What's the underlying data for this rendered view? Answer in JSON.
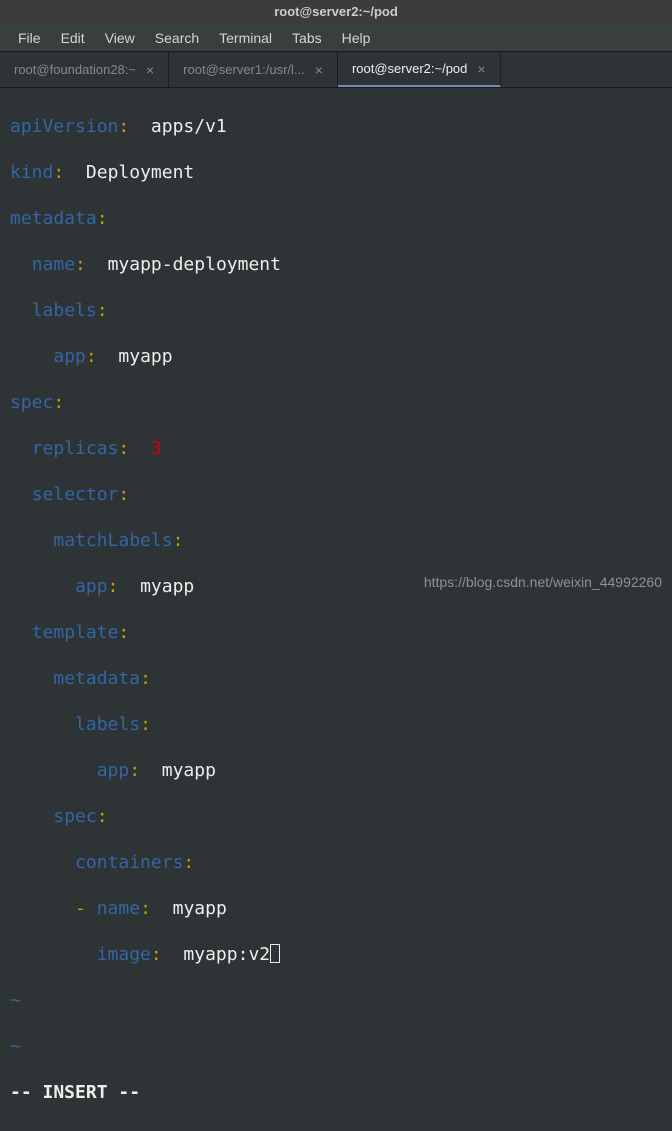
{
  "titlebar": {
    "title": "root@server2:~/pod"
  },
  "menu": {
    "file": "File",
    "edit": "Edit",
    "view": "View",
    "search": "Search",
    "terminal": "Terminal",
    "tabs": "Tabs",
    "help": "Help"
  },
  "tabs": [
    {
      "label": "root@foundation28:~",
      "active": false
    },
    {
      "label": "root@server1:/usr/l...",
      "active": false
    },
    {
      "label": "root@server2:~/pod",
      "active": true
    }
  ],
  "yaml": {
    "apiVersion_key": "apiVersion",
    "apiVersion_val": "apps/v1",
    "kind_key": "kind",
    "kind_val": "Deployment",
    "metadata_key": "metadata",
    "name_key": "name",
    "name_val": "myapp-deployment",
    "labels_key": "labels",
    "app_key": "app",
    "app_val": "myapp",
    "spec_key": "spec",
    "replicas_key": "replicas",
    "replicas_val": "3",
    "selector_key": "selector",
    "matchLabels_key": "matchLabels",
    "template_key": "template",
    "containers_key": "containers",
    "dash": "-",
    "cname_val": "myapp",
    "image_key": "image",
    "image_val": "myapp:v2"
  },
  "tilde": "~",
  "status_mode": "-- INSERT --",
  "watermark": "https://blog.csdn.net/weixin_44992260"
}
